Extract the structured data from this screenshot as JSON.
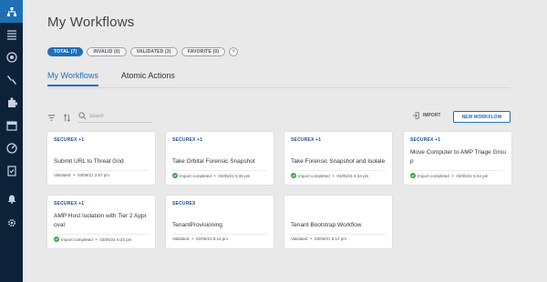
{
  "page": {
    "title": "My Workflows"
  },
  "filters": [
    {
      "label": "TOTAL (7)",
      "active": true
    },
    {
      "label": "INVALID (0)",
      "active": false
    },
    {
      "label": "VALIDATED (3)",
      "active": false
    },
    {
      "label": "FAVORITE (0)",
      "active": false
    }
  ],
  "filter_clear_icon": "×",
  "tabs": [
    {
      "label": "My Workflows",
      "active": true
    },
    {
      "label": "Atomic Actions",
      "active": false
    }
  ],
  "search": {
    "placeholder": "Search"
  },
  "actions": {
    "import_label": "IMPORT",
    "new_workflow_label": "NEW WORKFLOW"
  },
  "sidebar": {
    "items": [
      {
        "icon": "workflow-icon",
        "active": true
      },
      {
        "icon": "list-icon"
      },
      {
        "icon": "target-icon"
      },
      {
        "icon": "tools-icon"
      },
      {
        "icon": "puzzle-icon"
      },
      {
        "icon": "calendar-icon"
      },
      {
        "icon": "gauge-icon"
      },
      {
        "icon": "document-check-icon"
      },
      {
        "icon": "bell-icon"
      },
      {
        "icon": "gear-icon"
      }
    ]
  },
  "cards": [
    {
      "tag": "SECUREX +1",
      "title": "Submit URL to Threat Grid",
      "status": "Validated",
      "check": false,
      "date": "03/08/21 2:57 pm"
    },
    {
      "tag": "SECUREX +1",
      "title": "Take Orbital Forensic Snapshot",
      "status": "Import completed",
      "check": true,
      "date": "03/05/21 6:35 pm"
    },
    {
      "tag": "SECUREX +1",
      "title": "Take Forensic Snapshot and Isolate",
      "status": "Import completed",
      "check": true,
      "date": "03/05/21 6:34 pm"
    },
    {
      "tag": "SECUREX +1",
      "title": "Move Computer to AMP Triage Grou p",
      "status": "Import completed",
      "check": true,
      "date": "03/05/21 6:34 pm"
    },
    {
      "tag": "SECUREX +1",
      "title": "AMP Host Isolation with Tier 2 Appr oval",
      "status": "Import completed",
      "check": true,
      "date": "03/05/21 6:23 pm"
    },
    {
      "tag": "SECUREX",
      "title": "TenantProvisioning",
      "status": "Validated",
      "check": false,
      "date": "02/05/21 6:12 pm"
    },
    {
      "tag": "",
      "title": "Tenant Bootstrap Workflow",
      "status": "Validated",
      "check": false,
      "date": "03/05/21 6:10 pm"
    }
  ]
}
